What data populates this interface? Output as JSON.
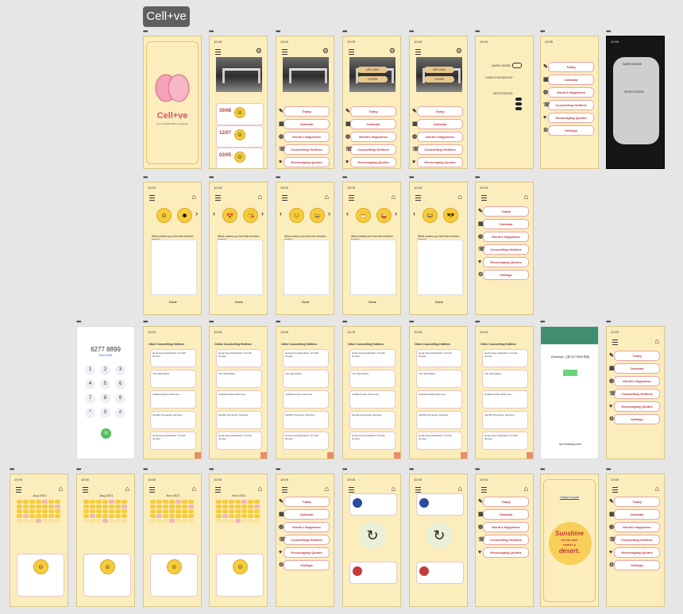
{
  "project": {
    "title": "Cell+ve"
  },
  "splash": {
    "app_name": "Cell+ve",
    "tagline": "Your mental health companion"
  },
  "menu": {
    "items": [
      {
        "label": "Today",
        "icon": "pencil-icon"
      },
      {
        "label": "Calendar",
        "icon": "calendar-icon"
      },
      {
        "label": "World's Happiness",
        "icon": "globe-icon"
      },
      {
        "label": "Counselling Hotlines",
        "icon": "phone-icon"
      },
      {
        "label": "Encouraging Quotes",
        "icon": "heart-icon"
      },
      {
        "label": "Settings",
        "icon": "gear-icon"
      }
    ]
  },
  "home": {
    "buttons": [
      "UPLOAD",
      "LOGIN"
    ]
  },
  "diary": {
    "entries": [
      {
        "date": "30",
        "month": "08"
      },
      {
        "date": "12",
        "month": "07"
      },
      {
        "date": "02",
        "month": "05"
      }
    ]
  },
  "settings": {
    "dark_mode": "DARK MODE",
    "login_label": "LOGIN FOR BACKUP",
    "notification": "NOTIFICATION"
  },
  "mood": {
    "question": "What makes you feel this emotion today?",
    "done": "Done"
  },
  "dialer": {
    "number": "6277 8899",
    "caller": "Send SMS",
    "keys": [
      "1",
      "2",
      "3",
      "4",
      "5",
      "6",
      "7",
      "8",
      "9",
      "*",
      "0",
      "#"
    ]
  },
  "hotlines": {
    "header": "Other Counselling Hotlines",
    "header_alt": "Online Counselling Hotlines",
    "items": [
      "Hong Kong Federation of Youth Groups",
      "The Samaritans",
      "Caritas Family Crisis Line",
      "Suicide Prevention Services"
    ]
  },
  "whatsapp": {
    "title": "WhatsApp 上與 62778899 對話",
    "url": "api.whatsapp.com"
  },
  "calendar": {
    "months": [
      "Aug 2021",
      "Aug 2021",
      "Nov 2021",
      "Nov 2021"
    ]
  },
  "quote": {
    "header": "Today's quote",
    "line1": "Sunshine",
    "line2": "all the time",
    "line3": "makes a",
    "line4": "desert."
  },
  "colors": {
    "bg": "#fcedbd",
    "accent": "#c23b3b",
    "emoji": "#f6cc3d"
  }
}
